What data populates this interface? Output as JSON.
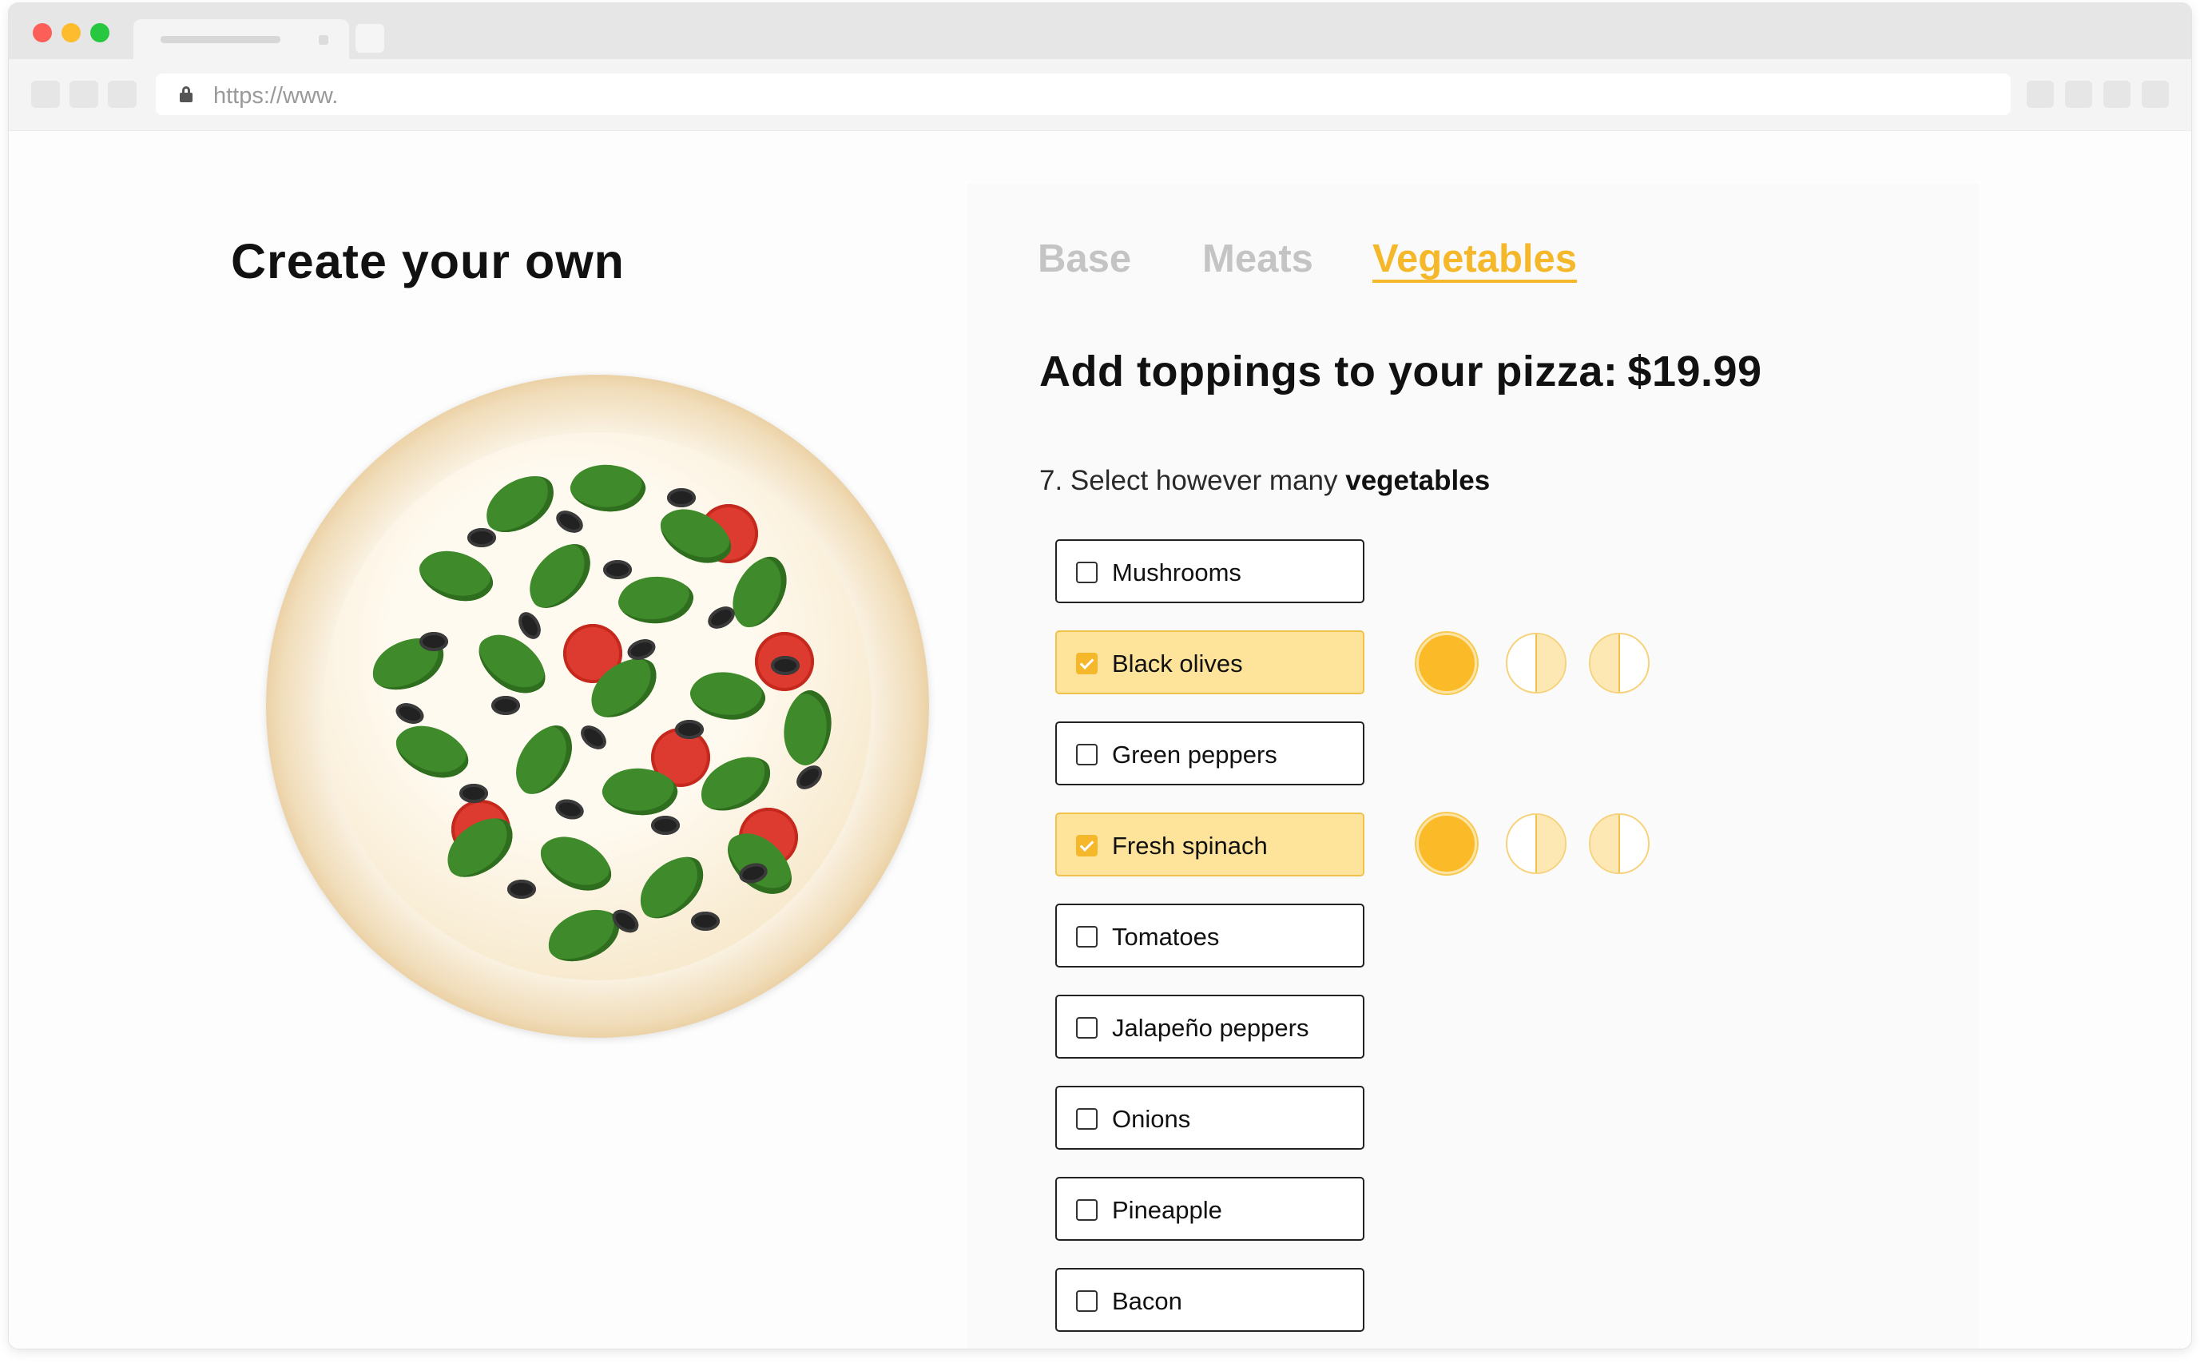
{
  "browser": {
    "url": "https://www."
  },
  "page": {
    "title": "Create your own"
  },
  "categories": [
    {
      "label": "Base",
      "active": false
    },
    {
      "label": "Meats",
      "active": false
    },
    {
      "label": "Vegetables",
      "active": true
    }
  ],
  "heading": {
    "text": "Add toppings to your pizza:",
    "price": "$19.99"
  },
  "instruction": {
    "prefix": "7. Select however many",
    "emphasis": "vegetables"
  },
  "toppings": [
    {
      "label": "Mushrooms",
      "checked": false
    },
    {
      "label": "Black olives",
      "checked": true
    },
    {
      "label": "Green peppers",
      "checked": false
    },
    {
      "label": "Fresh spinach",
      "checked": true
    },
    {
      "label": "Tomatoes",
      "checked": false
    },
    {
      "label": "Jalapeño peppers",
      "checked": false
    },
    {
      "label": "Onions",
      "checked": false
    },
    {
      "label": "Pineapple",
      "checked": false
    },
    {
      "label": "Bacon",
      "checked": false
    }
  ],
  "portion_options": [
    "whole-pizza",
    "left-half",
    "right-half"
  ],
  "colors": {
    "accent": "#f4b82a",
    "selected_bg": "#fee39a",
    "inactive_tab": "#c4c4c4"
  }
}
